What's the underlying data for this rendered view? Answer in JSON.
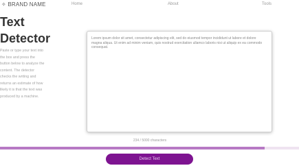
{
  "brand": {
    "name": "✧ BRAND NAME"
  },
  "nav": {
    "items": [
      {
        "label": "Home"
      },
      {
        "label": "About"
      },
      {
        "label": "Tools"
      }
    ]
  },
  "page": {
    "title": "Text\nDetector",
    "description": "Paste or type your text into the box and press the button below to analyze the content. The detector checks the writing and returns an estimate of how likely it is that the text was produced by a machine."
  },
  "editor": {
    "value": "Lorem ipsum dolor sit amet, consectetur adipiscing elit, sed do eiusmod tempor incididunt ut labore et dolore magna aliqua. Ut enim ad minim veniam, quis nostrud exercitation ullamco laboris nisi ut aliquip ex ea commodo consequat.",
    "char_count": "234 / 5000 characters"
  },
  "progress": {
    "fraction": 0.885
  },
  "actions": {
    "detect_label": "Detect Text"
  },
  "colors": {
    "accent": "#7e1491",
    "progress_fill": "#b779c4",
    "progress_track": "#efe3f1"
  }
}
